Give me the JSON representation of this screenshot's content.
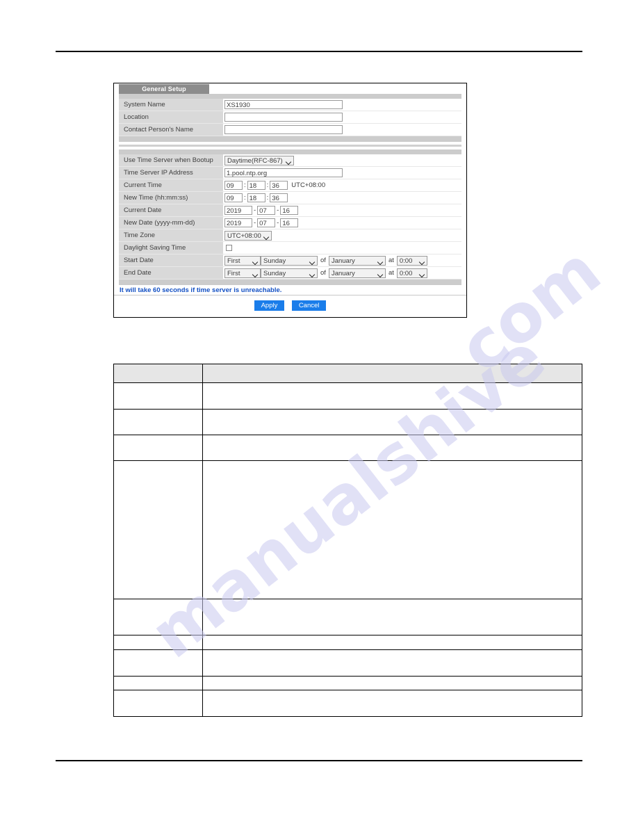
{
  "page": {
    "header_rule": true,
    "footer_rule": true,
    "watermarks": [
      "manualshive",
      "com"
    ]
  },
  "panel": {
    "tab_label": "General Setup",
    "general": {
      "rows": [
        {
          "label": "System Name",
          "value": "XS1930",
          "placeholder": ""
        },
        {
          "label": "Location",
          "value": "",
          "placeholder": ""
        },
        {
          "label": "Contact Person's Name",
          "value": "",
          "placeholder": ""
        }
      ]
    },
    "time": {
      "use_time_server": {
        "label": "Use Time Server when Bootup",
        "value": "Daytime(RFC-867)"
      },
      "time_server_ip": {
        "label": "Time Server IP Address",
        "value": "1.pool.ntp.org"
      },
      "current_time": {
        "label": "Current Time",
        "hour": "09",
        "minute": "18",
        "second": "36",
        "zone_suffix": "UTC+08:00"
      },
      "new_time": {
        "label": "New Time (hh:mm:ss)",
        "hour": "09",
        "minute": "18",
        "second": "36"
      },
      "current_date": {
        "label": "Current Date",
        "year": "2019",
        "month": "07",
        "day": "16"
      },
      "new_date": {
        "label": "New Date (yyyy-mm-dd)",
        "year": "2019",
        "month": "07",
        "day": "16"
      },
      "time_zone": {
        "label": "Time Zone",
        "value": "UTC+08:00"
      },
      "daylight_saving": {
        "label": "Daylight Saving Time",
        "checked": false
      },
      "start_date": {
        "label": "Start Date",
        "ordinal": "First",
        "weekday": "Sunday",
        "of_label": "of",
        "month": "January",
        "at_label": "at",
        "hour": "0:00"
      },
      "end_date": {
        "label": "End Date",
        "ordinal": "First",
        "weekday": "Sunday",
        "of_label": "of",
        "month": "January",
        "at_label": "at",
        "hour": "0:00"
      }
    },
    "note": "It will take 60 seconds if time server is unreachable.",
    "buttons": {
      "apply": "Apply",
      "cancel": "Cancel"
    },
    "accent_color": "#1a7dea",
    "note_color": "#1451c4"
  },
  "desc_table": {
    "headers": [
      "",
      ""
    ],
    "rows": [
      {
        "cells": [
          "",
          ""
        ],
        "height": 38
      },
      {
        "cells": [
          "",
          ""
        ],
        "height": 37
      },
      {
        "cells": [
          "",
          ""
        ],
        "height": 37
      },
      {
        "cells": [
          "",
          ""
        ],
        "height": 199
      },
      {
        "cells": [
          "",
          ""
        ],
        "height": 52
      },
      {
        "cells": [
          "",
          ""
        ],
        "height": 21
      },
      {
        "cells": [
          "",
          ""
        ],
        "height": 38
      },
      {
        "cells": [
          "",
          ""
        ],
        "height": 20
      },
      {
        "cells": [
          "",
          ""
        ],
        "height": 38
      }
    ]
  }
}
